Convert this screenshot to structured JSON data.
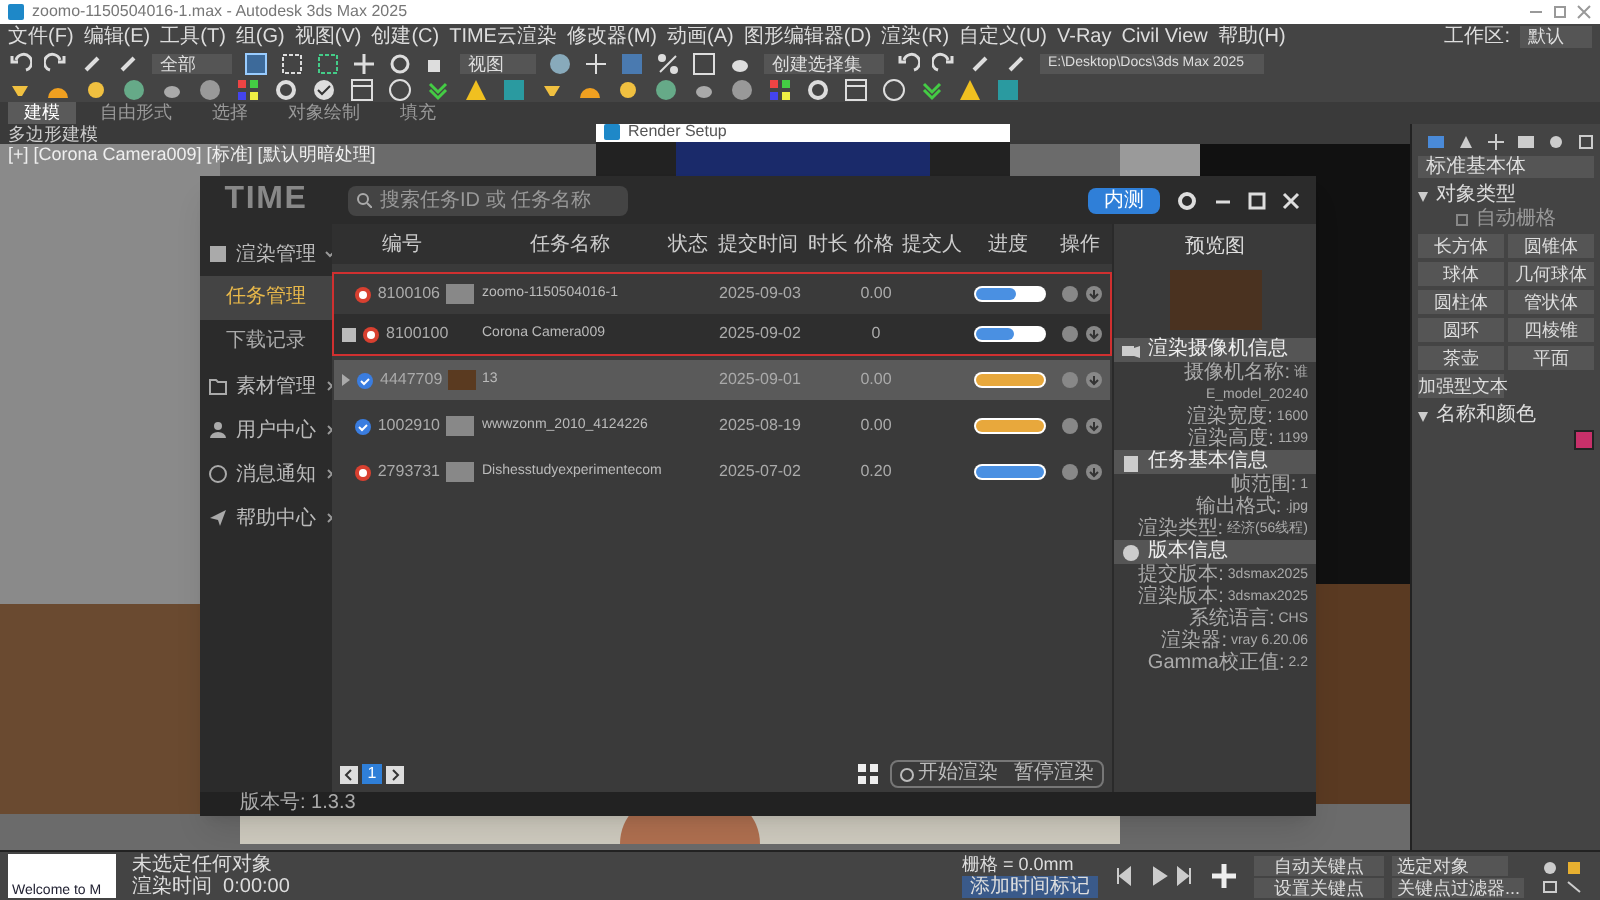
{
  "window": {
    "title": "zoomo-1150504016-1.max - Autodesk 3ds Max 2025"
  },
  "menu_bar": [
    "文件(F)",
    "编辑(E)",
    "工具(T)",
    "组(G)",
    "视图(V)",
    "创建(C)",
    "TIME云渲染",
    "修改器(M)",
    "动画(A)",
    "图形编辑器(D)",
    "渲染(R)",
    "自定义(U)",
    "V-Ray",
    "Civil View",
    "帮助(H)"
  ],
  "workspace": {
    "label": "工作区:",
    "value": "默认"
  },
  "toolbar": {
    "selection_filter": "全部",
    "view_mode": "视图",
    "named_selection": "创建选择集",
    "project_path": "E:\\Desktop\\Docs\\3ds Max 2025"
  },
  "ribbon_tabs": [
    {
      "label": "建模",
      "selected": true
    },
    {
      "label": "自由形式",
      "selected": false
    },
    {
      "label": "选择",
      "selected": false
    },
    {
      "label": "对象绘制",
      "selected": false
    },
    {
      "label": "填充",
      "selected": false
    }
  ],
  "ribbon_subtitle": "多边形建模",
  "viewport": {
    "label": "[+] [Corona Camera009] [标准] [默认明暗处理]"
  },
  "render_setup": {
    "title": "Render Setup"
  },
  "plugin": {
    "logo": "TIME",
    "search": {
      "placeholder": "搜索任务ID 或 任务名称"
    },
    "header_button": "内测",
    "sidebar": [
      {
        "label": "渲染管理",
        "expanded": true,
        "children": [
          {
            "label": "任务管理",
            "selected": true
          },
          {
            "label": "下载记录",
            "selected": false
          }
        ]
      },
      {
        "label": "素材管理",
        "expanded": false
      },
      {
        "label": "用户中心",
        "expanded": false
      },
      {
        "label": "消息通知",
        "expanded": false
      },
      {
        "label": "帮助中心",
        "expanded": false
      }
    ],
    "columns": [
      "编号",
      "任务名称",
      "状态",
      "提交时间",
      "时长",
      "价格",
      "提交人",
      "进度",
      "操作"
    ],
    "rows": [
      {
        "id": "8100106",
        "name": "zoomo-1150504016-1",
        "submitted": "2025-09-03",
        "price": "0.00",
        "failed": true,
        "photo_thumbnail": false,
        "selected": false,
        "outlined": true,
        "progress": {
          "level": 0.6,
          "color": "#4a90e2"
        },
        "children": [
          {
            "id": "8100100",
            "name": "Corona Camera009",
            "submitted": "2025-09-02",
            "price": "0",
            "failed": true,
            "checked": false,
            "progress": {
              "level": 0.55,
              "color": "#4a90e2"
            }
          }
        ]
      },
      {
        "id": "4447709",
        "name": "13",
        "submitted": "2025-09-01",
        "price": "0.00",
        "failed": false,
        "photo_thumbnail": true,
        "selected": true,
        "outlined": false,
        "progress": {
          "level": 1,
          "color": "#e8a83c"
        }
      },
      {
        "id": "1002910",
        "name": "wwwzonm_2010_4124226",
        "submitted": "2025-08-19",
        "price": "0.00",
        "failed": false,
        "photo_thumbnail": false,
        "selected": false,
        "outlined": false,
        "progress": {
          "level": 1,
          "color": "#e8a83c"
        }
      },
      {
        "id": "2793731",
        "name": "Dishesstudyexperimentecom",
        "submitted": "2025-07-02",
        "price": "0.20",
        "failed": true,
        "photo_thumbnail": false,
        "selected": false,
        "outlined": false,
        "progress": {
          "level": 1,
          "color": "#4a90e2"
        }
      }
    ],
    "pager": [
      {
        "label": "1",
        "selected": true
      }
    ],
    "actions": [
      "开始渲染",
      "暂停渲染"
    ],
    "version": "版本号: 1.3.3",
    "preview": {
      "title": "预览图",
      "sections": [
        {
          "title": "渲染摄像机信息",
          "fields": [
            {
              "label": "摄像机名称:",
              "value": "谁"
            },
            {
              "value": "E_model_20240"
            },
            {
              "label": "渲染宽度:",
              "value": "1600"
            },
            {
              "label": "渲染高度:",
              "value": "1199"
            }
          ]
        },
        {
          "title": "任务基本信息",
          "fields": [
            {
              "label": "帧范围:",
              "value": "1"
            },
            {
              "label": "输出格式:",
              "value": ".jpg"
            },
            {
              "label": "渲染类型:",
              "value": "经济(56线程)"
            }
          ]
        },
        {
          "title": "版本信息",
          "fields": [
            {
              "label": "提交版本:",
              "value": "3dsmax2025"
            },
            {
              "label": "渲染版本:",
              "value": "3dsmax2025"
            },
            {
              "label": "系统语言:",
              "value": "CHS"
            },
            {
              "label": "渲染器:",
              "value": "vray 6.20.06"
            },
            {
              "label": "Gamma校正值:",
              "value": "2.2"
            }
          ]
        }
      ]
    }
  },
  "command_panel": {
    "category": "标准基本体",
    "sections": [
      {
        "title": "对象类型",
        "expanded": true,
        "option": {
          "label": "自动栅格",
          "checked": false
        },
        "buttons": [
          "长方体",
          "圆锥体",
          "球体",
          "几何球体",
          "圆柱体",
          "管状体",
          "圆环",
          "四棱锥",
          "茶壶",
          "平面",
          "加强型文本"
        ]
      },
      {
        "title": "名称和颜色",
        "expanded": true,
        "color": "#c8306a"
      }
    ]
  },
  "status": {
    "script": "Welcome to M",
    "selection": "未选定任何对象",
    "render_time": "渲染时间  0:00:00",
    "grid": "栅格 = 0.0mm",
    "add_tag": "添加时间标记",
    "auto_key": "自动关键点",
    "key_mode": "选定对象",
    "set_key": "设置关键点",
    "key_filter": "关键点过滤器..."
  }
}
